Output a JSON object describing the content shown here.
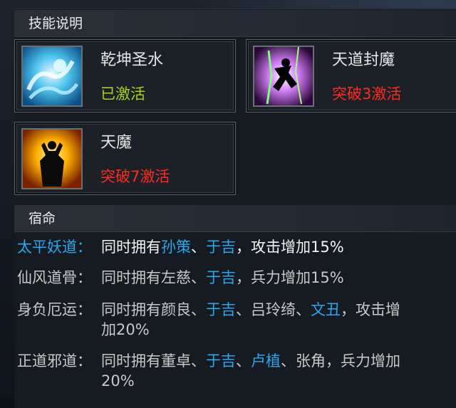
{
  "skills_section": {
    "title": "技能说明"
  },
  "skills": [
    {
      "name": "乾坤圣水",
      "status": "已激活",
      "status_color": "#a8d21a",
      "icon": "water-dragon-icon"
    },
    {
      "name": "天道封魔",
      "status": "突破3激活",
      "status_color": "#ff2b1e",
      "icon": "purple-lightning-silhouette-icon"
    },
    {
      "name": "天魔",
      "status": "突破7激活",
      "status_color": "#ff2b1e",
      "icon": "fire-demon-silhouette-icon"
    }
  ],
  "fate_section": {
    "title": "宿命"
  },
  "fates": [
    {
      "label": "太平妖道：",
      "label_color": "#2aa7ee",
      "parts": [
        {
          "text": "同时拥有",
          "style": "white"
        },
        {
          "text": "孙策",
          "style": "hl"
        },
        {
          "text": "、",
          "style": "white"
        },
        {
          "text": "于吉",
          "style": "hl"
        },
        {
          "text": "，攻击增加15%",
          "style": "white"
        }
      ]
    },
    {
      "label": "仙风道骨：",
      "label_color": "#c8c8c8",
      "parts": [
        {
          "text": "同时拥有左慈、",
          "style": "grey"
        },
        {
          "text": "于吉",
          "style": "hl"
        },
        {
          "text": "，兵力增加15%",
          "style": "grey"
        }
      ]
    },
    {
      "label": "身负厄运：",
      "label_color": "#c8c8c8",
      "parts": [
        {
          "text": "同时拥有颜良、",
          "style": "grey"
        },
        {
          "text": "于吉",
          "style": "hl"
        },
        {
          "text": "、吕玲绮、",
          "style": "grey"
        },
        {
          "text": "文丑",
          "style": "hl"
        },
        {
          "text": "，攻击增加20%",
          "style": "grey"
        }
      ]
    },
    {
      "label": "正道邪道：",
      "label_color": "#c8c8c8",
      "parts": [
        {
          "text": "同时拥有董卓、",
          "style": "grey"
        },
        {
          "text": "于吉",
          "style": "hl"
        },
        {
          "text": "、",
          "style": "grey"
        },
        {
          "text": "卢植",
          "style": "hl"
        },
        {
          "text": "、张角，兵力增加20%",
          "style": "grey"
        }
      ]
    }
  ]
}
